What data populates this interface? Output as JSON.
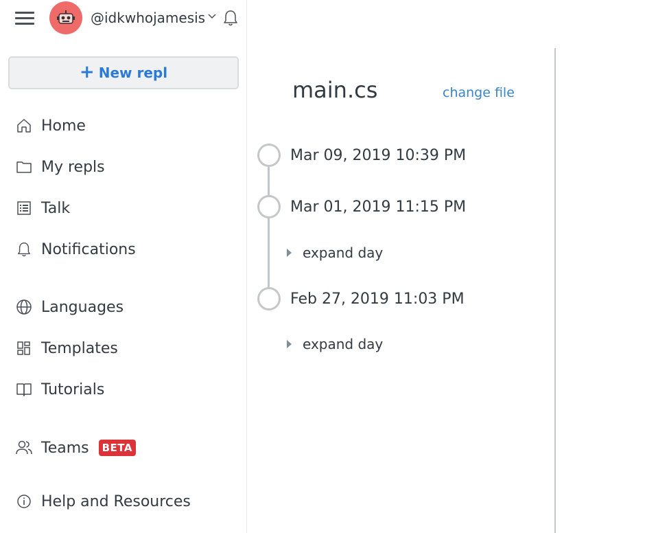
{
  "header": {
    "username": "@idkwhojamesis",
    "menu_icon": "hamburger-icon",
    "avatar_icon": "robot-avatar",
    "chevron_icon": "chevron-down-icon",
    "bell_icon": "bell-icon"
  },
  "sidebar": {
    "new_repl": {
      "icon": "+",
      "label": "New repl"
    },
    "items": [
      {
        "label": "Home",
        "icon": "home-icon"
      },
      {
        "label": "My repls",
        "icon": "folder-icon"
      },
      {
        "label": "Talk",
        "icon": "list-icon"
      },
      {
        "label": "Notifications",
        "icon": "bell-icon"
      },
      {
        "label": "Languages",
        "icon": "globe-icon"
      },
      {
        "label": "Templates",
        "icon": "templates-icon"
      },
      {
        "label": "Tutorials",
        "icon": "book-icon"
      },
      {
        "label": "Teams",
        "icon": "users-icon",
        "badge": "BETA"
      },
      {
        "label": "Help and Resources",
        "icon": "info-icon"
      }
    ]
  },
  "main": {
    "filename": "main.cs",
    "change_file": "change file",
    "versions": [
      {
        "timestamp": "Mar 09, 2019 10:39 PM"
      },
      {
        "timestamp": "Mar 01, 2019 11:15 PM",
        "expand": "expand day"
      },
      {
        "timestamp": "Feb 27, 2019 11:03 PM",
        "expand": "expand day"
      }
    ]
  },
  "colors": {
    "accent": "#2b7bd6",
    "link": "#3a85c9",
    "avatar": "#ee6b69",
    "badge": "#dc3339",
    "timeline": "#c4c7ca"
  }
}
